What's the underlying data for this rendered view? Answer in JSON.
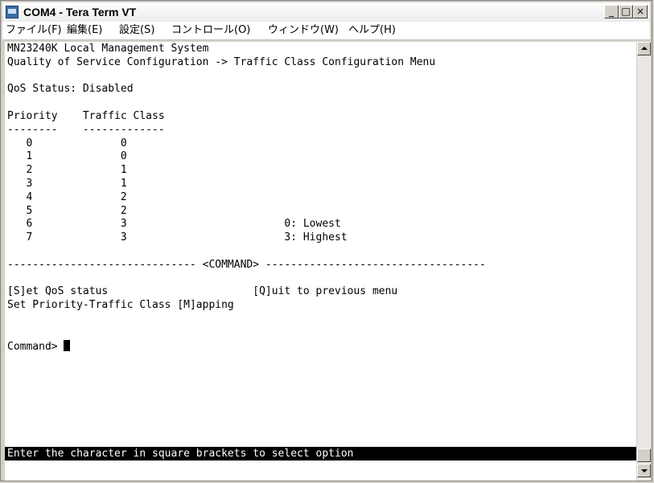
{
  "window": {
    "title": "COM4 - Tera Term VT",
    "minimize": "_",
    "maximize": "□",
    "close": "×"
  },
  "menu": [
    "ファイル(F)",
    "編集(E)",
    "設定(S)",
    "コントロール(O)",
    "ウィンドウ(W)",
    "ヘルプ(H)"
  ],
  "terminal": {
    "lines": [
      "MN23240K Local Management System",
      "Quality of Service Configuration -> Traffic Class Configuration Menu",
      "",
      "QoS Status: Disabled",
      "",
      "Priority    Traffic Class",
      "--------    -------------",
      "   0              0",
      "   1              0",
      "   2              1",
      "   3              1",
      "   4              2",
      "   5              2",
      "   6              3                         0: Lowest",
      "   7              3                         3: Highest",
      "",
      "------------------------------ <COMMAND> -----------------------------------",
      "",
      "[S]et QoS status                       [Q]uit to previous menu",
      "Set Priority-Traffic Class [M]apping",
      "",
      "",
      "Command> "
    ],
    "status_line": "Enter the character in square brackets to select option"
  }
}
